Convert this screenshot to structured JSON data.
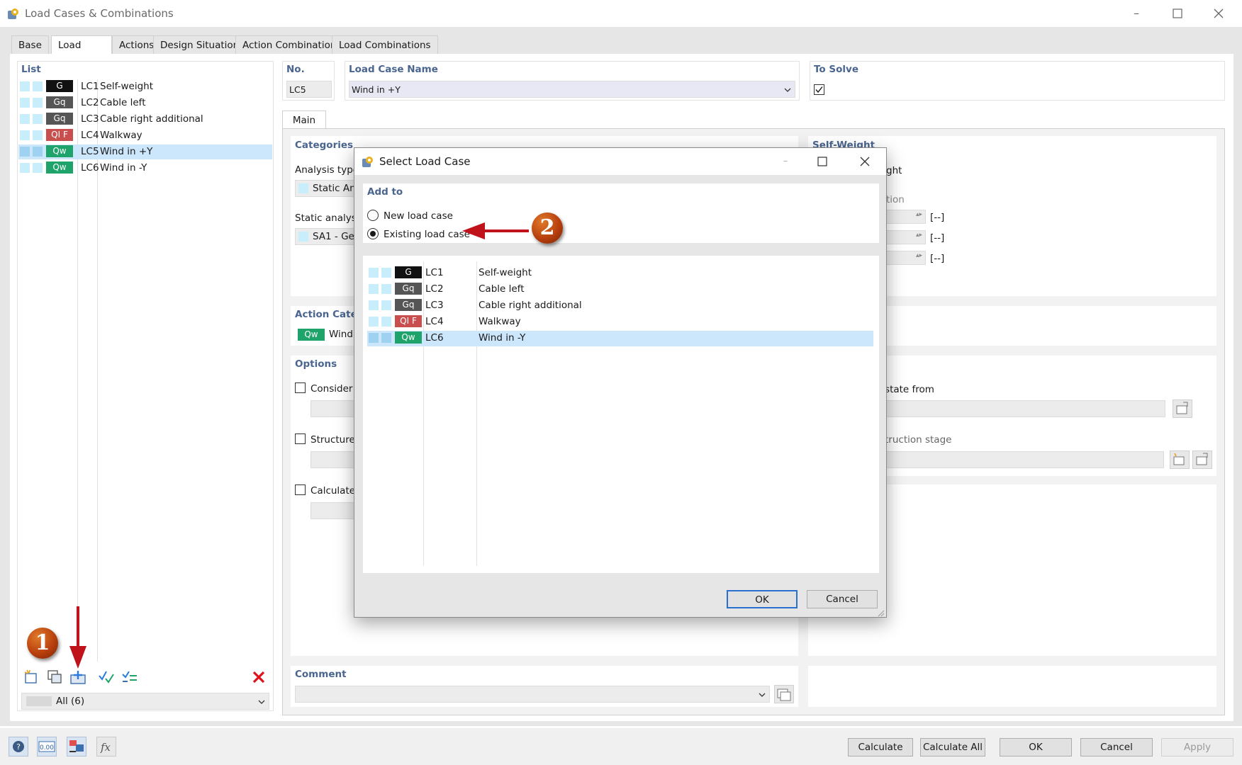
{
  "window": {
    "title": "Load Cases & Combinations"
  },
  "tabs": [
    "Base",
    "Load Cases",
    "Actions",
    "Design Situations",
    "Action Combinations",
    "Load Combinations"
  ],
  "list": {
    "title": "List",
    "items": [
      {
        "badge": "G",
        "badge_color": "#111111",
        "code": "LC1",
        "name": "Self-weight"
      },
      {
        "badge": "Gq",
        "badge_color": "#555555",
        "code": "LC2",
        "name": "Cable left"
      },
      {
        "badge": "Gq",
        "badge_color": "#555555",
        "code": "LC3",
        "name": "Cable right additional"
      },
      {
        "badge": "QI F",
        "badge_color": "#c94f4f",
        "code": "LC4",
        "name": "Walkway"
      },
      {
        "badge": "Qw",
        "badge_color": "#1ea36a",
        "code": "LC5",
        "name": "Wind in +Y"
      },
      {
        "badge": "Qw",
        "badge_color": "#1ea36a",
        "code": "LC6",
        "name": "Wind in -Y"
      }
    ],
    "filter": "All (6)"
  },
  "header": {
    "no_label": "No.",
    "no_value": "LC5",
    "name_label": "Load Case Name",
    "name_value": "Wind in +Y",
    "to_solve_label": "To Solve"
  },
  "main_tab": "Main",
  "categories": {
    "title": "Categories",
    "analysis_type_label": "Analysis type",
    "analysis_type_value": "Static Anal",
    "static_analysis_label": "Static analysis",
    "static_analysis_value": "SA1 - Geo"
  },
  "action_category": {
    "title": "Action Catego",
    "badge": "Qw",
    "value": "Wind"
  },
  "options": {
    "title": "Options",
    "items": [
      "Consider i",
      "Structure n",
      "Calculate c"
    ]
  },
  "self_weight": {
    "title": "Self-Weight",
    "frag1": "ght",
    "frag2": "tion",
    "unit": "[--]",
    "frag3": "l state from",
    "frag4": "truction stage"
  },
  "comment": {
    "title": "Comment"
  },
  "dialog": {
    "title": "Select Load Case",
    "add_to_title": "Add to",
    "option_new": "New load case",
    "option_existing": "Existing load case",
    "rows": [
      {
        "badge": "G",
        "code": "LC1",
        "name": "Self-weight"
      },
      {
        "badge": "Gq",
        "code": "LC2",
        "name": "Cable left"
      },
      {
        "badge": "Gq",
        "code": "LC3",
        "name": "Cable right additional"
      },
      {
        "badge": "QI F",
        "code": "LC4",
        "name": "Walkway"
      },
      {
        "badge": "Qw",
        "code": "LC6",
        "name": "Wind in -Y"
      }
    ],
    "ok": "OK",
    "cancel": "Cancel"
  },
  "markers": {
    "one": "1",
    "two": "2"
  },
  "bottom_buttons": [
    "Calculate",
    "Calculate All",
    "OK",
    "Cancel",
    "Apply"
  ],
  "bottom_icons": [
    "help-icon",
    "units-icon",
    "display-icon",
    "formula-icon"
  ],
  "colors": {
    "accent_title": "#4a6590",
    "selection": "#cce6fb",
    "arrow": "#c0121b"
  }
}
